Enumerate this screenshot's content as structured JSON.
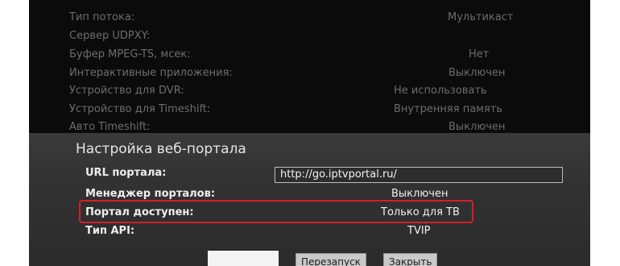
{
  "background_settings": {
    "rows": [
      {
        "label": "Тип потока:",
        "value": "Мультикаст"
      },
      {
        "label": "Сервер UDPXY:",
        "value": ""
      },
      {
        "label": "Буфер MPEG-TS, мсек:",
        "value": "Нет"
      },
      {
        "label": "Интерактивные приложения:",
        "value": "Выключен"
      },
      {
        "label": "Устройство для DVR:",
        "value": "Не использовать"
      },
      {
        "label": "Устройство для Timeshift:",
        "value": "Внутренняя память"
      },
      {
        "label": "Авто Timeshift:",
        "value": "Выключен"
      }
    ]
  },
  "dialog": {
    "title": "Настройка веб-портала",
    "url_label": "URL портала:",
    "url_value": "http://go.iptvportal.ru/",
    "manager_label": "Менеджер порталов:",
    "manager_value": "Выключен",
    "available_label": "Портал доступен:",
    "available_value": "Только для ТВ",
    "api_label": "Тип API:",
    "api_value": "TVIP",
    "restart_button": "Перезапуск",
    "close_button": "Закрыть"
  },
  "colors": {
    "highlight": "#d3202a",
    "dialog_bg": "#333333",
    "screen_bg": "#0b0b0b"
  }
}
